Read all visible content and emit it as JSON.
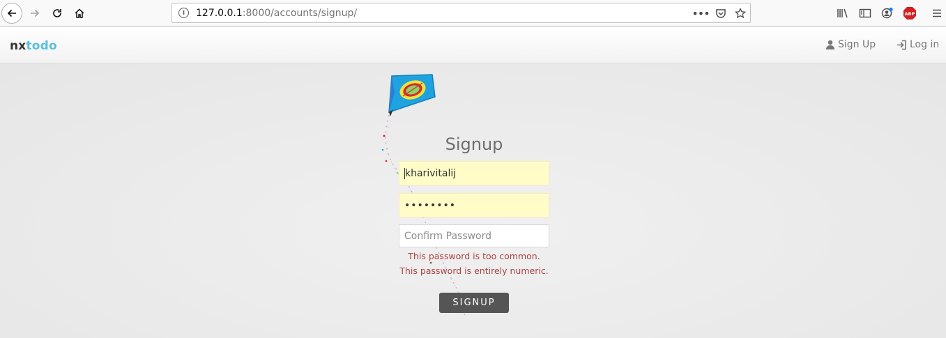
{
  "browser": {
    "url_host": "127.0.0.1",
    "url_rest": ":8000/accounts/signup/",
    "abp_label": "ABP"
  },
  "navbar": {
    "brand_a": "nx",
    "brand_b": "todo",
    "signup_label": "Sign Up",
    "login_label": "Log in"
  },
  "form": {
    "title": "Signup",
    "username_value": "kharivitalij",
    "password_value": "••••••••",
    "confirm_placeholder": "Confirm Password",
    "errors": [
      "This password is too common.",
      "This password is entirely numeric."
    ],
    "submit_label": "SIGNUP"
  },
  "colors": {
    "brand_accent": "#5bc0de",
    "error": "#a94442",
    "autofill_bg": "#fffcc8",
    "button_bg": "#555555"
  }
}
